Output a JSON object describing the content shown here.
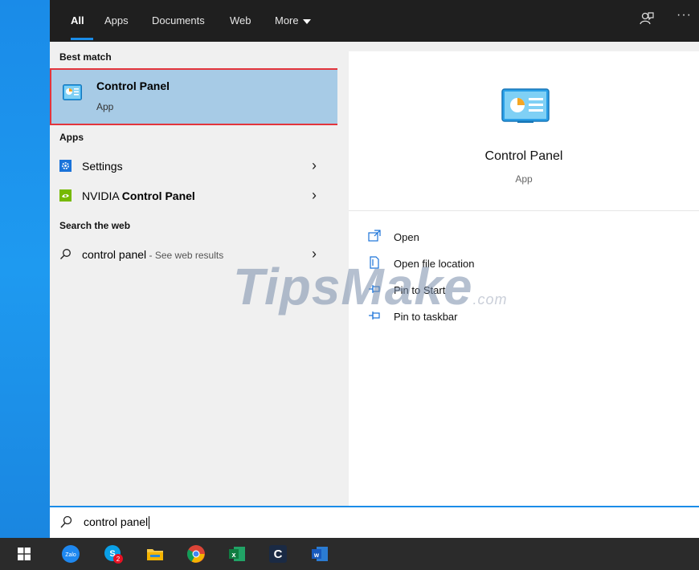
{
  "tabs": [
    {
      "label": "All",
      "active": true
    },
    {
      "label": "Apps"
    },
    {
      "label": "Documents"
    },
    {
      "label": "Web"
    },
    {
      "label": "More"
    }
  ],
  "topbar_icons": {
    "feedback": "feedback-icon",
    "more_options": "···"
  },
  "sections": {
    "best_match": "Best match",
    "apps": "Apps",
    "search_web": "Search the web"
  },
  "best_match": {
    "title": "Control Panel",
    "subtitle": "App"
  },
  "apps": [
    {
      "label": "Settings",
      "icon": "settings-gear-icon"
    },
    {
      "label_prefix": "NVIDIA ",
      "label_bold": "Control Panel",
      "icon": "nvidia-icon"
    }
  ],
  "web_result": {
    "query": "control panel",
    "suffix": " - See web results"
  },
  "preview": {
    "title": "Control Panel",
    "subtitle": "App"
  },
  "actions": [
    {
      "label": "Open",
      "icon": "open-icon"
    },
    {
      "label": "Open file location",
      "icon": "file-location-icon"
    },
    {
      "label": "Pin to Start",
      "icon": "pin-icon"
    },
    {
      "label": "Pin to taskbar",
      "icon": "pin-icon"
    }
  ],
  "search": {
    "value": "control panel"
  },
  "taskbar": {
    "apps": [
      "start",
      "zalo",
      "skype",
      "file-explorer",
      "chrome",
      "excel",
      "ccleaner",
      "word"
    ],
    "skype_badge": "2",
    "zalo_text": "Zalo"
  },
  "watermark": {
    "main": "TipsMake",
    "suffix": ".com"
  },
  "colors": {
    "accent": "#1a8ce8",
    "selected_bg": "#a7cbe6",
    "highlight_border": "#e3353c",
    "topbar": "#1f1f1f"
  }
}
